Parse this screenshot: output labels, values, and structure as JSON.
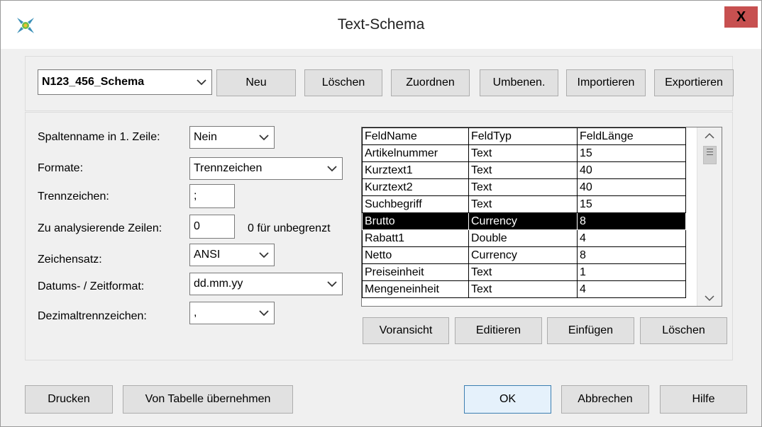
{
  "window": {
    "title": "Text-Schema",
    "close": "X"
  },
  "schema_select": {
    "value": "N123_456_Schema"
  },
  "top_buttons": [
    "Neu",
    "Löschen",
    "Zuordnen",
    "Umbenen.",
    "Importieren",
    "Exportieren"
  ],
  "settings": {
    "header_row": {
      "label": "Spaltenname in 1. Zeile:",
      "value": "Nein"
    },
    "format": {
      "label": "Formate:",
      "value": "Trennzeichen"
    },
    "delimiter": {
      "label": "Trennzeichen:",
      "value": ";"
    },
    "rows_to_analyze": {
      "label": "Zu analysierende Zeilen:",
      "value": "0",
      "hint": "0 für unbegrenzt"
    },
    "charset": {
      "label": "Zeichensatz:",
      "value": "ANSI"
    },
    "date_format": {
      "label": "Datums- / Zeitformat:",
      "value": "dd.mm.yy"
    },
    "decimal_sep": {
      "label": "Dezimaltrennzeichen:",
      "value": ","
    }
  },
  "fields_table": {
    "columns": [
      "FeldName",
      "FeldTyp",
      "FeldLänge"
    ],
    "rows": [
      [
        "Artikelnummer",
        "Text",
        "15"
      ],
      [
        "Kurztext1",
        "Text",
        "40"
      ],
      [
        "Kurztext2",
        "Text",
        "40"
      ],
      [
        "Suchbegriff",
        "Text",
        "15"
      ],
      [
        "Brutto",
        "Currency",
        "8"
      ],
      [
        "Rabatt1",
        "Double",
        "4"
      ],
      [
        "Netto",
        "Currency",
        "8"
      ],
      [
        "Preiseinheit",
        "Text",
        "1"
      ],
      [
        "Mengeneinheit",
        "Text",
        "4"
      ]
    ],
    "selected_index": 4
  },
  "table_buttons": [
    "Voransicht",
    "Editieren",
    "Einfügen",
    "Löschen"
  ],
  "footer": {
    "print": "Drucken",
    "from_table": "Von Tabelle übernehmen",
    "ok": "OK",
    "cancel": "Abbrechen",
    "help": "Hilfe"
  }
}
